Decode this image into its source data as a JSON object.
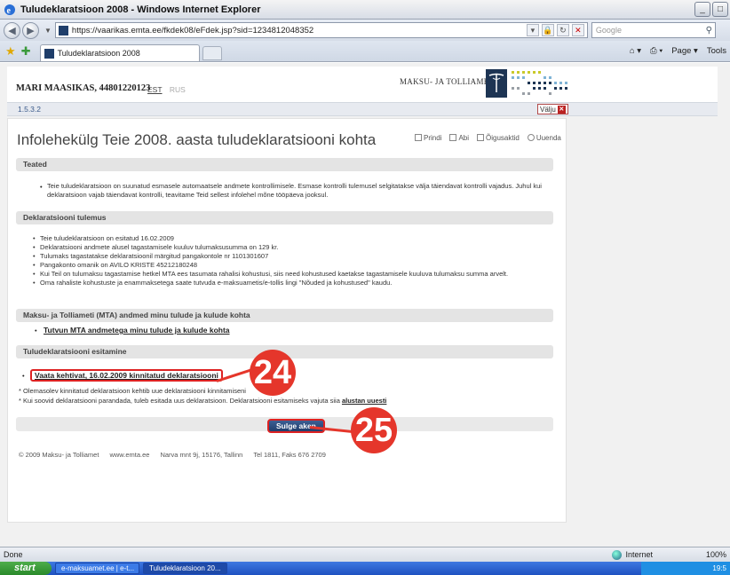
{
  "window": {
    "title": "Tuludeklaratsioon 2008 - Windows Internet Explorer",
    "minimize": "_",
    "maximize": "□"
  },
  "browser": {
    "url": "https://vaarikas.emta.ee/fkdek08/eFdek.jsp?sid=1234812048352",
    "search_placeholder": "Google",
    "tab_label": "Tuludeklaratsioon 2008",
    "tools": [
      "Page ▾",
      "Tools"
    ],
    "status_left": "Done",
    "status_zone": "Internet",
    "zoom": "100%"
  },
  "header": {
    "user": "MARI MAASIKAS, 44801220123",
    "lang_active": "EST",
    "lang_other": "RUS",
    "agency": "MAKSU- JA TOLLIAMET"
  },
  "breadcrumb": "1.5.3.2",
  "exit_label": "Välju",
  "page": {
    "title": "Infolehekülg Teie 2008. aasta tuludeklaratsiooni kohta",
    "tools": [
      "Prindi",
      "Abi",
      "Õigusaktid",
      "Uuenda"
    ]
  },
  "sections": {
    "teated": {
      "heading": "Teated",
      "text": "Teie tuludeklaratsioon on suunatud esmasele automaatsele andmete kontrollimisele. Esmase kontrolli tulemusel selgitatakse välja täiendavat kontrolli vajadus. Juhul kui deklaratsioon vajab täiendavat kontrolli, teavitame Teid sellest infolehel mõne tööpäeva jooksul."
    },
    "tulemus": {
      "heading": "Deklaratsiooni tulemus",
      "items": [
        "Teie tuludeklaratsioon on esitatud 16.02.2009",
        "Deklaratsiooni andmete alusel tagastamisele kuuluv tulumaksusumma on 129 kr.",
        "Tulumaks tagastatakse deklaratsioonil märgitud pangakontole nr 1101301607",
        "Pangakonto omanik on AVILO KRISTE 45212180248",
        "Kui Teil on tulumaksu tagastamise hetkel MTA ees tasumata rahalisi kohustusi, siis need kohustused kaetakse tagastamisele kuuluva tulumaksu summa arvelt.",
        "Oma rahaliste kohustuste ja enammaksetega saate tutvuda e-maksuametis/e-tollis lingi \"Nõuded ja kohustused\" kaudu."
      ]
    },
    "mta": {
      "heading": "Maksu- ja Tolliameti (MTA) andmed minu tulude ja kulude kohta",
      "link": "Tutvun MTA andmetega minu tulude ja kulude kohta"
    },
    "esitamine": {
      "heading": "Tuludeklaratsiooni esitamine",
      "link": "Vaata kehtivat, 16.02.2009 kinnitatud deklaratsiooni",
      "note1": "* Olemasolev kinnitatud deklaratsioon kehtib uue deklaratsiooni kinnitamiseni",
      "note2_prefix": "* Kui soovid deklaratsiooni parandada, tuleb esitada uus deklaratsioon. Deklaratsiooni esitamiseks vajuta siia",
      "note2_link": "alustan uuesti"
    }
  },
  "close_button": "Sulge aken",
  "footer": {
    "copyright": "© 2009 Maksu- ja Tolliamet",
    "site": "www.emta.ee",
    "address": "Narva mnt 9j, 15176, Tallinn",
    "phone": "Tel 1811, Faks 676 2709"
  },
  "callouts": [
    "24",
    "25"
  ],
  "taskbar": {
    "start": "start",
    "tasks": [
      "e-maksuamet.ee | e-t...",
      "Tuludeklaratsioon 20..."
    ],
    "clock": "19:5"
  },
  "colors": {
    "callout": "#e5362b",
    "highlight": "#dd2222",
    "button": "#203e6c"
  }
}
